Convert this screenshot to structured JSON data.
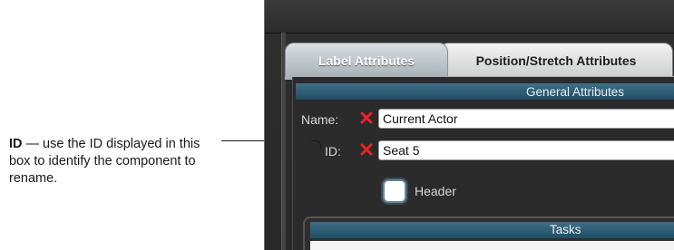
{
  "callout": {
    "term": "ID",
    "text": " — use the ID displayed in this box to identify the component to rename."
  },
  "tabs": [
    {
      "label": "Label Attributes",
      "active": true
    },
    {
      "label": "Position/Stretch Attributes",
      "active": false
    }
  ],
  "general": {
    "title": "General Attributes",
    "name_label": "Name:",
    "name_value": "Current Actor",
    "id_label": "ID:",
    "id_value": "Seat 5",
    "header_label": "Header"
  },
  "tasks": {
    "title": "Tasks"
  },
  "colors": {
    "x_icon": "#e8232a",
    "section_header": "#2c5c73"
  }
}
